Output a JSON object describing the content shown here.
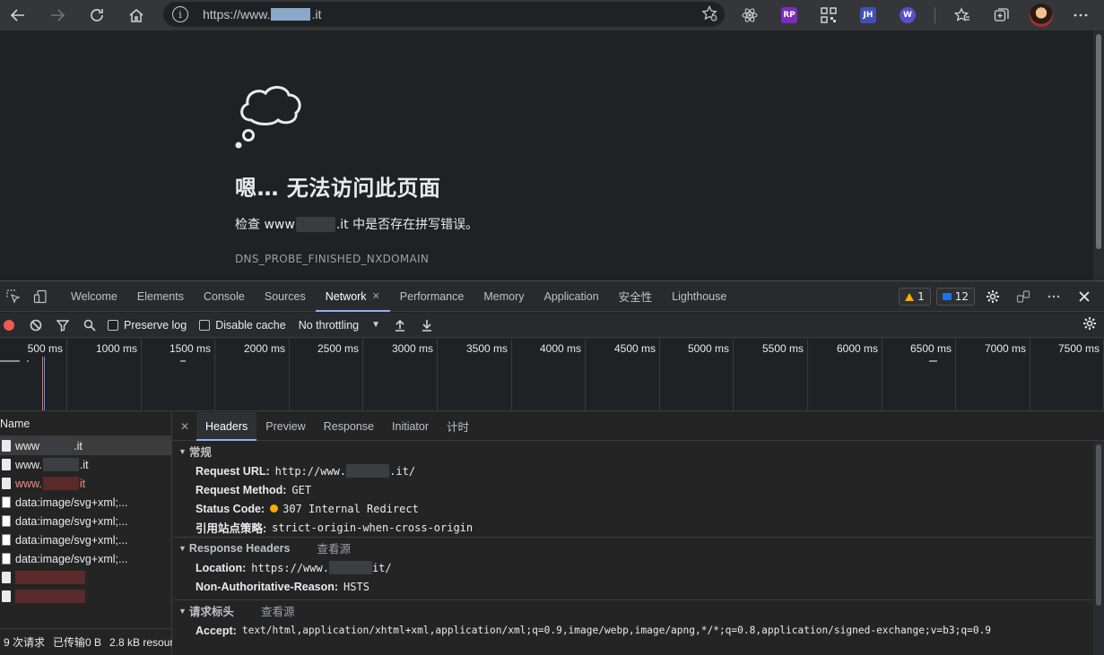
{
  "browser": {
    "url_prefix": "https://www.",
    "url_suffix": ".it",
    "info_icon": "i"
  },
  "page": {
    "error_title": "嗯… 无法访问此页面",
    "error_desc_prefix": "检查 www",
    "error_desc_suffix": ".it 中是否存在拼写错误。",
    "error_code": "DNS_PROBE_FINISHED_NXDOMAIN"
  },
  "devtools": {
    "tabs": [
      {
        "label": "Welcome"
      },
      {
        "label": "Elements"
      },
      {
        "label": "Console"
      },
      {
        "label": "Sources"
      },
      {
        "label": "Network"
      },
      {
        "label": "Performance"
      },
      {
        "label": "Memory"
      },
      {
        "label": "Application"
      },
      {
        "label": "安全性"
      },
      {
        "label": "Lighthouse"
      }
    ],
    "active_tab": "Network",
    "warnings_count": "1",
    "messages_count": "12"
  },
  "network_toolbar": {
    "preserve_log": "Preserve log",
    "disable_cache": "Disable cache",
    "throttling": "No throttling"
  },
  "timeline": {
    "ticks": [
      "500 ms",
      "1000 ms",
      "1500 ms",
      "2000 ms",
      "2500 ms",
      "3000 ms",
      "3500 ms",
      "4000 ms",
      "4500 ms",
      "5000 ms",
      "5500 ms",
      "6000 ms",
      "6500 ms",
      "7000 ms",
      "7500 ms"
    ]
  },
  "requests": {
    "header": "Name",
    "rows": [
      {
        "prefix": "www",
        "suffix": ".it"
      },
      {
        "prefix": "www.",
        "suffix": ".it"
      },
      {
        "prefix": "www.",
        "suffix": "it"
      },
      {
        "name": "data:image/svg+xml;..."
      },
      {
        "name": "data:image/svg+xml;..."
      },
      {
        "name": "data:image/svg+xml;..."
      },
      {
        "name": "data:image/svg+xml;..."
      }
    ],
    "status_requests": "9 次请求",
    "status_transferred": "已传输0 B",
    "status_resources": "2.8 kB resour"
  },
  "detail": {
    "tabs": [
      {
        "label": "Headers"
      },
      {
        "label": "Preview"
      },
      {
        "label": "Response"
      },
      {
        "label": "Initiator"
      },
      {
        "label": "计时"
      }
    ],
    "general": {
      "title": "常规",
      "request_url_label": "Request URL:",
      "request_url_prefix": "http://www.",
      "request_url_suffix": ".it/",
      "method_label": "Request Method:",
      "method": "GET",
      "status_label": "Status Code:",
      "status": "307 Internal Redirect",
      "referrer_label": "引用站点策略:",
      "referrer": "strict-origin-when-cross-origin"
    },
    "response_headers": {
      "title": "Response Headers",
      "view_source": "查看源",
      "location_label": "Location:",
      "location_prefix": "https://www.",
      "location_suffix": "it/",
      "nar_label": "Non-Authoritative-Reason:",
      "nar": "HSTS"
    },
    "request_headers": {
      "title": "请求标头",
      "view_source": "查看源",
      "accept_label": "Accept:",
      "accept": "text/html,application/xhtml+xml,application/xml;q=0.9,image/webp,image/apng,*/*;q=0.8,application/signed-exchange;v=b3;q=0.9"
    }
  }
}
